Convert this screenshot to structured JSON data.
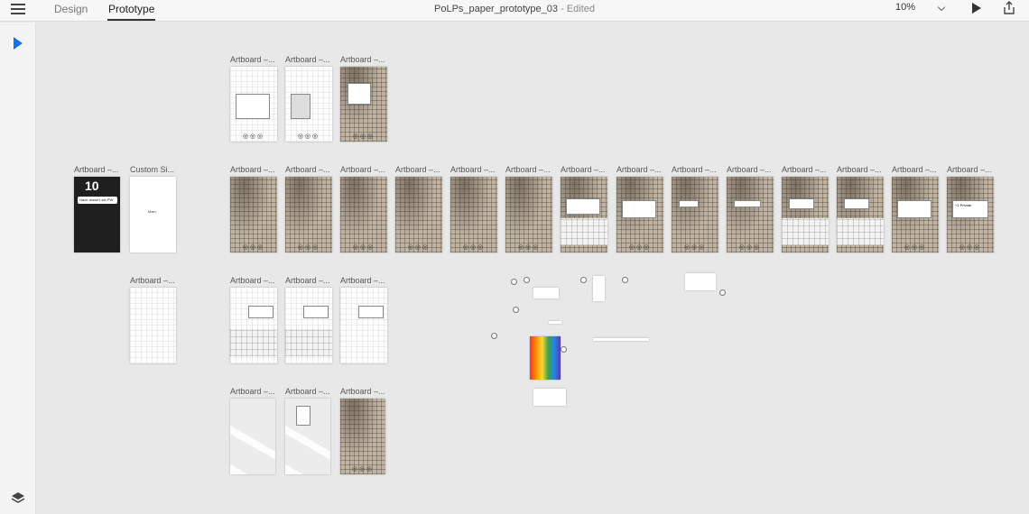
{
  "topbar": {
    "tabs": [
      {
        "label": "Design"
      },
      {
        "label": "Prototype"
      }
    ],
    "active_tab": "Prototype",
    "document_title": "PoLPs_paper_prototype_03",
    "document_status": " - Edited",
    "zoom": "10%",
    "icons": {
      "menu": "hamburger-menu-icon",
      "play": "play-icon",
      "share": "share-icon"
    }
  },
  "toolbar": {
    "tools": [
      {
        "name": "select-tool",
        "icon": "pointer-arrow-icon",
        "active": true
      },
      {
        "name": "layers",
        "icon": "layers-icon"
      }
    ],
    "accent_color": "#1473e6"
  },
  "canvas": {
    "artboard_labels": {
      "artboard": "Artboard –...",
      "custom": "Custom Si..."
    },
    "dark_board": {
      "time": "10",
      "pill": "Have doesn't set PW"
    },
    "last_card_text": "+1 Private",
    "custom_card_text": "Main"
  }
}
